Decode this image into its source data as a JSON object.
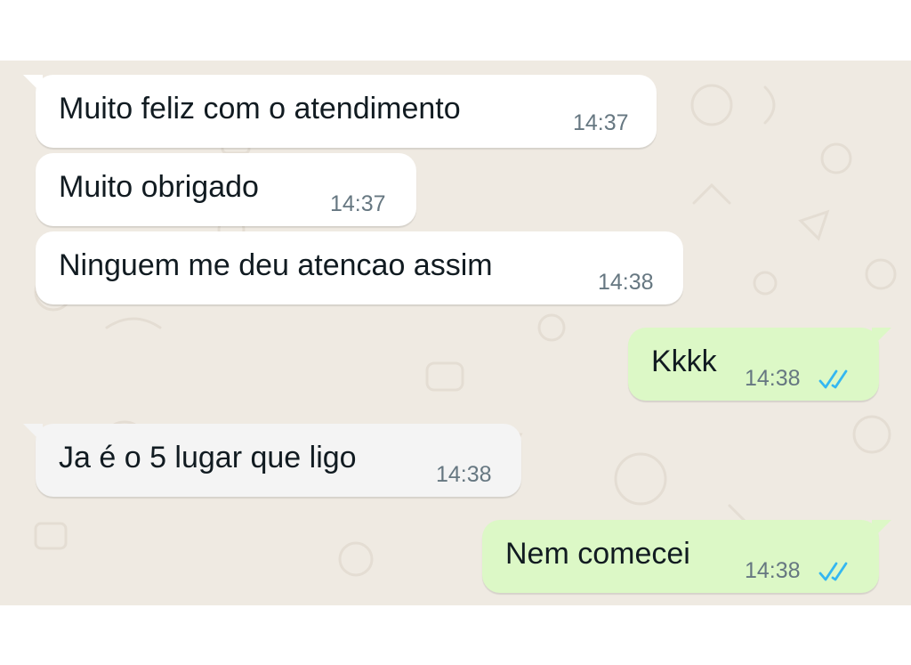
{
  "conversation": {
    "messages": [
      {
        "direction": "incoming",
        "text": "Muito feliz com o atendimento",
        "time": "14:37"
      },
      {
        "direction": "incoming",
        "text": "Muito obrigado",
        "time": "14:37"
      },
      {
        "direction": "incoming",
        "text": "Ninguem me deu atencao assim",
        "time": "14:38"
      },
      {
        "direction": "outgoing",
        "text": "Kkkk",
        "time": "14:38",
        "status": "read",
        "status_icon": "double-check-icon"
      },
      {
        "direction": "incoming",
        "text": "Ja é o 5 lugar que ligo",
        "time": "14:38"
      },
      {
        "direction": "outgoing",
        "text": "Nem comecei",
        "time": "14:38",
        "status": "read",
        "status_icon": "double-check-icon"
      }
    ]
  },
  "colors": {
    "chat_background": "#efeae2",
    "incoming_bubble": "#ffffff",
    "outgoing_bubble": "#dcf8c6",
    "read_ticks": "#34b7f1",
    "timestamp": "#667781"
  }
}
